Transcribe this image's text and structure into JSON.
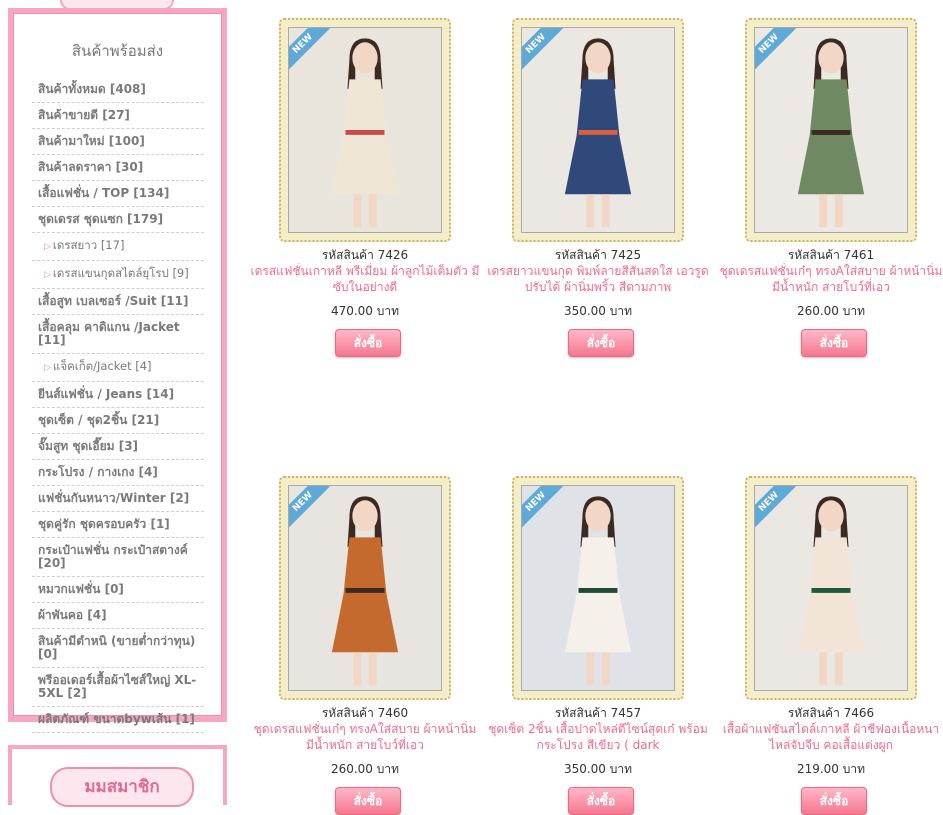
{
  "sidebar": {
    "title": "สินค้าพร้อมส่ง",
    "categories": [
      {
        "label": "สินค้าทั้งหมด [408]",
        "sub": false
      },
      {
        "label": "สินค้าขายดี [27]",
        "sub": false
      },
      {
        "label": "สินค้ามาใหม่ [100]",
        "sub": false
      },
      {
        "label": "สินค้าลดราคา [30]",
        "sub": false
      },
      {
        "label": "เสื้อแฟชั่น / TOP [134]",
        "sub": false
      },
      {
        "label": "ชุดเดรส ชุดแซก [179]",
        "sub": false
      },
      {
        "label": "เดรสยาว [17]",
        "sub": true
      },
      {
        "label": "เดรสแขนกุดสไตล์ยุโรป [9]",
        "sub": true
      },
      {
        "label": "เสื้อสูท เบลเซอร์ /Suit [11]",
        "sub": false
      },
      {
        "label": "เสื้อคลุม คาดิแกน /Jacket [11]",
        "sub": false
      },
      {
        "label": "แจ็คเก็ต/Jacket [4]",
        "sub": true
      },
      {
        "label": "ยีนส์แฟชั่น / Jeans [14]",
        "sub": false
      },
      {
        "label": "ชุดเซ็ต / ชุด2ชิ้น [21]",
        "sub": false
      },
      {
        "label": "จั๊มสูท ชุดเอี๊ยม [3]",
        "sub": false
      },
      {
        "label": "กระโปรง / กางเกง [4]",
        "sub": false
      },
      {
        "label": "แฟชั่นกันหนาว/Winter [2]",
        "sub": false
      },
      {
        "label": "ชุดคู่รัก ชุดครอบครัว [1]",
        "sub": false
      },
      {
        "label": "กระเป๋าแฟชั่น กระเป๋าสตางค์ [20]",
        "sub": false
      },
      {
        "label": "หมวกแฟชั่น [0]",
        "sub": false
      },
      {
        "label": "ผ้าพันคอ [4]",
        "sub": false
      },
      {
        "label": "สินค้ามีตำหนิ (ขายต่ำกว่าทุน) [0]",
        "sub": false
      },
      {
        "label": "พรีออเดอร์เสื้อผ้าไซส์ใหญ่ XL-5XL [2]",
        "sub": false
      },
      {
        "label": "ผลิตภัณฑ์ ขนาดbywเส้น [1]",
        "sub": false
      }
    ],
    "member_label": "มมสมาชิก"
  },
  "products": [
    {
      "code": "รหัสสินค้า 7426",
      "name": "เดรสแฟชั่นเกาหลี พรีเมี่ยม ผ้าลูกไม้เต็มตัว มีซับในอย่างดี",
      "price": "470.00 บาท",
      "badge": "NEW",
      "buy": "สั่งซื้อ",
      "colors": {
        "bg": "#e9e4dc",
        "main": "#efe6d6",
        "accent": "#c94a4a"
      }
    },
    {
      "code": "รหัสสินค้า 7425",
      "name": "เดรสยาวแขนกุด พิมพ์ลายสีสันสดใส เอวรูดปรับได้ ผ้านิ่มพริ้ว สีตามภาพ",
      "price": "350.00 บาท",
      "badge": "NEW",
      "buy": "สั่งซื้อ",
      "colors": {
        "bg": "#ebe7e2",
        "main": "#2f4a7a",
        "accent": "#d9603f"
      }
    },
    {
      "code": "รหัสสินค้า 7461",
      "name": "ชุดเดรสแฟชั่นเก๋ๆ ทรงAใส่สบาย ผ้าหน้านิ่ม มีน้ำหนัก สายโบว์ที่เอว",
      "price": "260.00 บาท",
      "badge": "NEW",
      "buy": "สั่งซื้อ",
      "colors": {
        "bg": "#ece9e4",
        "main": "#6f8a62",
        "accent": "#3a2a22"
      }
    },
    {
      "code": "รหัสสินค้า 7460",
      "name": "ชุดเดรสแฟชั่นเก๋ๆ ทรงAใส่สบาย ผ้าหน้านิ่ม มีน้ำหนัก สายโบว์ที่เอว",
      "price": "260.00 บาท",
      "badge": "NEW",
      "buy": "สั่งซื้อ",
      "colors": {
        "bg": "#e8e4df",
        "main": "#c56a2f",
        "accent": "#3a2a22"
      }
    },
    {
      "code": "รหัสสินค้า 7457",
      "name": "ชุดเซ็ต 2ชิ้น เสื้อปาดไหล่ดีไซน์สุดเก๋ พร้อมกระโปรง สีเขียว ( dark",
      "price": "350.00 บาท",
      "badge": "NEW",
      "buy": "สั่งซื้อ",
      "colors": {
        "bg": "#dfe3e8",
        "main": "#f5f1ea",
        "accent": "#1f4a35"
      }
    },
    {
      "code": "รหัสสินค้า 7466",
      "name": "เสื้อผ้าแฟชั่นสไตล์เกาหลี ผ้าชีฟองเนื้อหนา ไหล่จับจีบ คอเสื้อแต่งผูก",
      "price": "219.00 บาท",
      "badge": "NEW",
      "buy": "สั่งซื้อ",
      "colors": {
        "bg": "#ebe8e4",
        "main": "#f3e4d8",
        "accent": "#1f5a3a"
      }
    }
  ]
}
